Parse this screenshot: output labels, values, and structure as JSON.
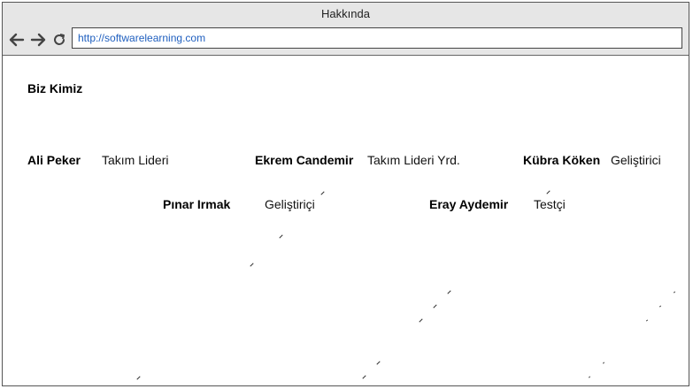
{
  "window": {
    "title": "Hakkında"
  },
  "toolbar": {
    "url": "http://softwarelearning.com",
    "back_icon": "back-arrow-icon",
    "forward_icon": "forward-arrow-icon",
    "reload_icon": "reload-icon"
  },
  "page": {
    "heading": "Biz Kimiz",
    "team": [
      {
        "name": "Ali Peker",
        "role": "Takım Lideri"
      },
      {
        "name": "Ekrem Candemir",
        "role": "Takım Lideri Yrd."
      },
      {
        "name": "Kübra Köken",
        "role": "Geliştirici"
      },
      {
        "name": "Pınar Irmak",
        "role": "Geliştiriçi"
      },
      {
        "name": "Eray Aydemir",
        "role": "Testçi"
      }
    ]
  },
  "colors": {
    "chrome": "#e6e6e6",
    "link": "#1f5fbf",
    "border": "#555555"
  }
}
